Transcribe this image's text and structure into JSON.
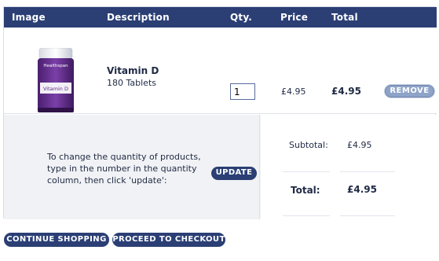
{
  "table_header": {
    "image": "Image",
    "description": "Description",
    "qty": "Qty.",
    "price": "Price",
    "total": "Total"
  },
  "items": [
    {
      "image_label": "Healthspan",
      "image_product": "Vitamin D",
      "name": "Vitamin D",
      "detail": "180 Tablets",
      "quantity": "1",
      "price": "£4.95",
      "total": "£4.95",
      "remove_label": "REMOVE"
    }
  ],
  "help": {
    "text": "To change the quantity of products, type in the number in the quantity column, then click 'update':",
    "update_label": "UPDATE"
  },
  "summary": {
    "subtotal_label": "Subtotal:",
    "subtotal_value": "£4.95",
    "total_label": "Total:",
    "total_value": "£4.95"
  },
  "actions": {
    "continue_label": "CONTINUE SHOPPING",
    "checkout_label": "PROCEED TO CHECKOUT"
  },
  "colors": {
    "header_bg": "#2b3f75",
    "button_bg": "#2b3f75",
    "remove_bg": "#8ea3c8",
    "footer_bg": "#f1f2f5",
    "text": "#1f2a44"
  }
}
